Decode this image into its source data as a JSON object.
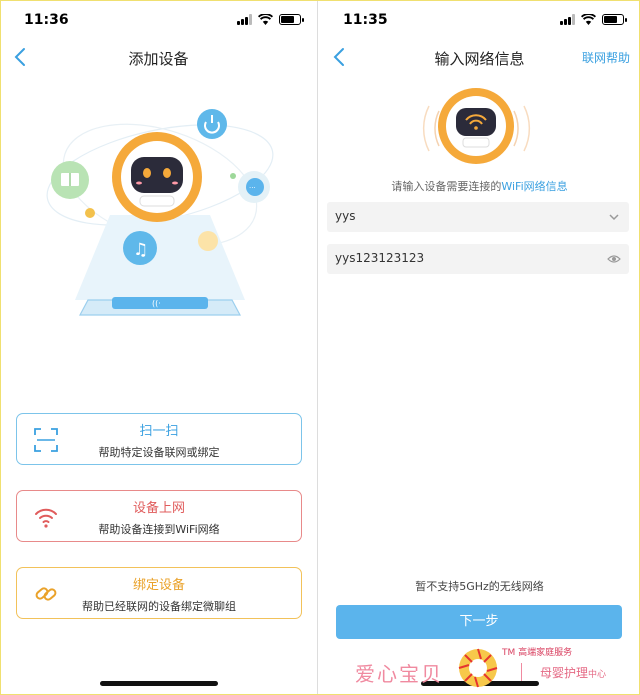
{
  "left": {
    "time": "11:36",
    "title": "添加设备",
    "cards": [
      {
        "title": "扫一扫",
        "desc": "帮助特定设备联网或绑定"
      },
      {
        "title": "设备上网",
        "desc": "帮助设备连接到WiFi网络"
      },
      {
        "title": "绑定设备",
        "desc": "帮助已经联网的设备绑定微聊组"
      }
    ]
  },
  "right": {
    "time": "11:35",
    "title": "输入网络信息",
    "help_label": "联网帮助",
    "info_prefix": "请输入设备需要连接的",
    "info_highlight": "WiFi网络信息",
    "ssid_value": "yys",
    "password_value": "yys123123123",
    "note": "暂不支持5GHz的无线网络",
    "next_label": "下一步"
  },
  "watermark": {
    "brand": "爱心宝贝",
    "tm_text": "TM 高端家庭服务",
    "sub_main": "母婴护理",
    "sub_small": "中心"
  },
  "colors": {
    "accent": "#3aa0e0",
    "button": "#5bb4ec",
    "scan_border": "#7cc4ea",
    "wifi_border": "#e88a8a",
    "bind_border": "#f2c25a",
    "robot_orange": "#f5a93a"
  },
  "icons": {
    "back": "chevron-left-icon",
    "scan": "scan-icon",
    "wifi": "wifi-icon",
    "link": "link-icon",
    "dropdown": "chevron-down-icon",
    "eye": "eye-icon"
  }
}
